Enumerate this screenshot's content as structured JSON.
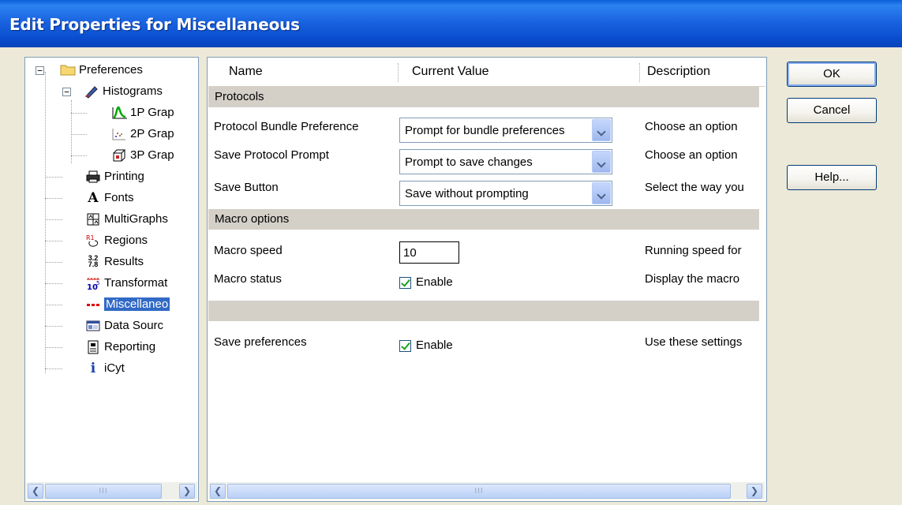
{
  "window": {
    "title": "Edit Properties for Miscellaneous"
  },
  "tree": {
    "items": [
      {
        "label": "Preferences",
        "icon": "folder-icon"
      },
      {
        "label": "Histograms",
        "icon": "histogram-brush-icon"
      },
      {
        "label": "1P Grap",
        "icon": "1p-graph-icon"
      },
      {
        "label": "2P Grap",
        "icon": "2p-graph-icon"
      },
      {
        "label": "3P Grap",
        "icon": "3p-graph-icon"
      },
      {
        "label": "Printing",
        "icon": "printer-icon"
      },
      {
        "label": "Fonts",
        "icon": "font-icon"
      },
      {
        "label": "MultiGraphs",
        "icon": "multigraph-icon"
      },
      {
        "label": "Regions",
        "icon": "regions-icon"
      },
      {
        "label": "Results",
        "icon": "results-icon"
      },
      {
        "label": "Transformat",
        "icon": "transformation-icon"
      },
      {
        "label": "Miscellaneo",
        "icon": "miscellaneous-icon"
      },
      {
        "label": "Data Sourc",
        "icon": "data-source-icon"
      },
      {
        "label": "Reporting",
        "icon": "reporting-icon"
      },
      {
        "label": "iCyt",
        "icon": "info-icon"
      }
    ],
    "scroll_grip": "III"
  },
  "grid": {
    "headers": {
      "name": "Name",
      "value": "Current Value",
      "description": "Description"
    },
    "sections": {
      "protocols": "Protocols",
      "macro": "Macro options",
      "blank": ""
    },
    "rows": {
      "bundle": {
        "name": "Protocol Bundle Preference",
        "value": "Prompt for bundle preferences",
        "description": "Choose an option"
      },
      "save_prompt": {
        "name": "Save Protocol Prompt",
        "value": "Prompt to save changes",
        "description": "Choose an option"
      },
      "save_button": {
        "name": "Save Button",
        "value": "Save without prompting",
        "description": "Select the way you"
      },
      "macro_speed": {
        "name": "Macro speed",
        "value": "10",
        "description": "Running speed for"
      },
      "macro_status": {
        "name": "Macro status",
        "value": "Enable",
        "checked": true,
        "description": "Display the macro"
      },
      "save_prefs": {
        "name": "Save preferences",
        "value": "Enable",
        "checked": true,
        "description": "Use these settings"
      }
    },
    "scroll_grip": "III"
  },
  "buttons": {
    "ok": "OK",
    "cancel": "Cancel",
    "help": "Help..."
  },
  "colors": {
    "titlebar": "#0a4ed0",
    "selection": "#316ac5",
    "dialog": "#ece9d8",
    "section": "#d4d0c8"
  }
}
